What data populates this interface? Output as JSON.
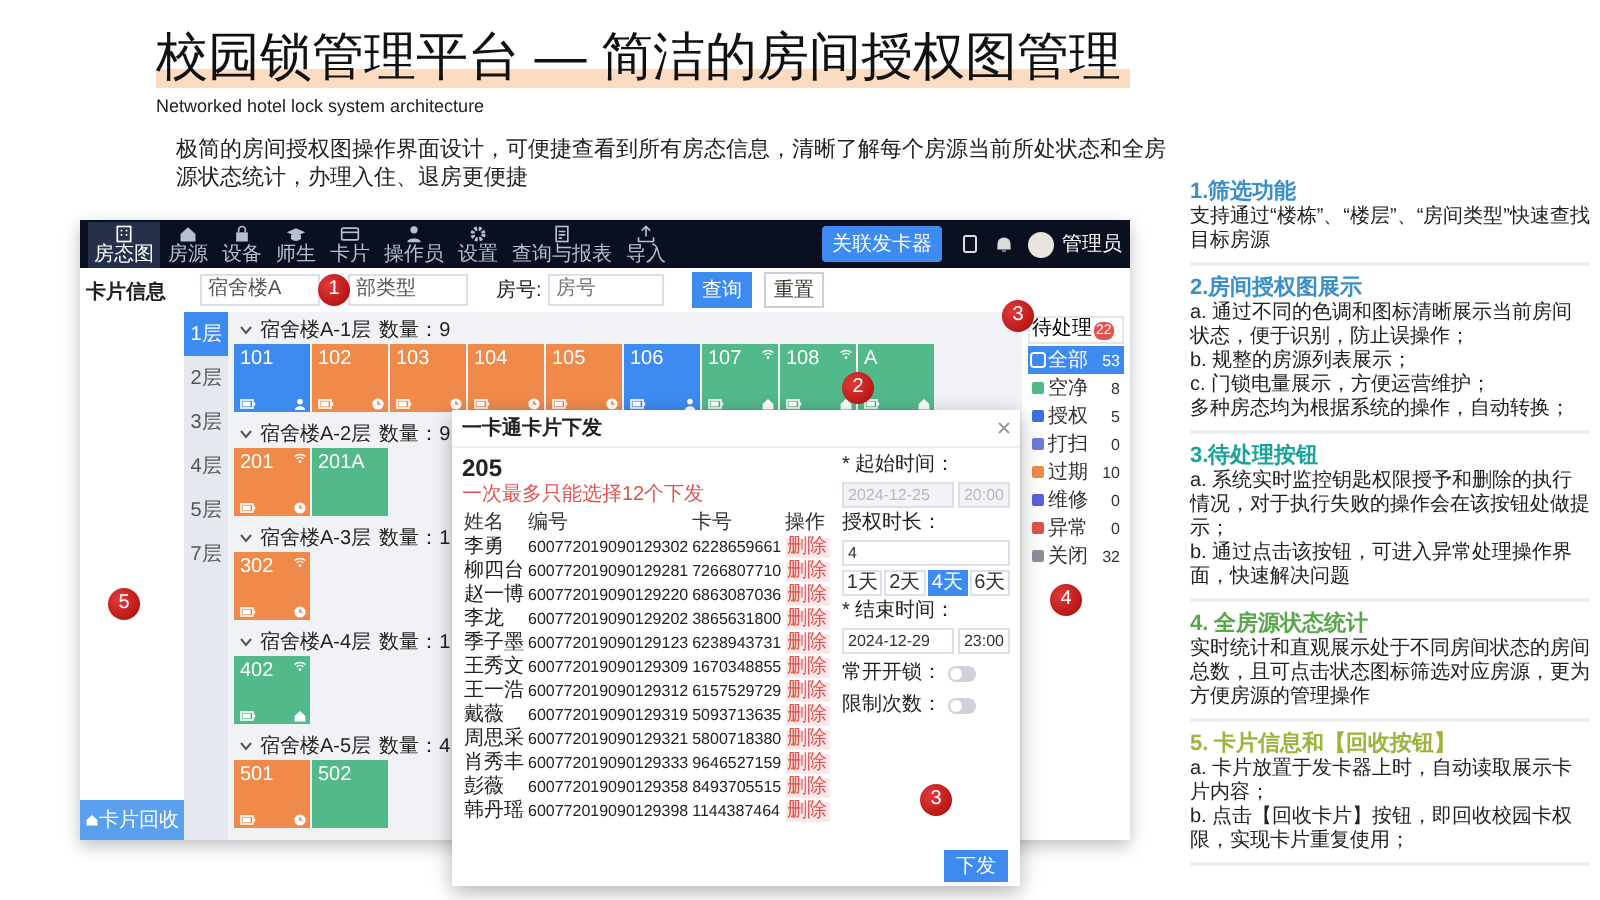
{
  "slide": {
    "title": "校园锁管理平台 — 简洁的房间授权图管理",
    "subtitle": "Networked hotel lock system architecture",
    "description": "极简的房间授权图操作界面设计，可便捷查看到所有房态信息，清晰了解每个房源当前所处状态和全房源状态统计，办理入住、退房更便捷"
  },
  "app": {
    "nav": [
      {
        "label": "房态图",
        "selected": true
      },
      {
        "label": "房源",
        "selected": false
      },
      {
        "label": "设备",
        "selected": false
      },
      {
        "label": "师生",
        "selected": false
      },
      {
        "label": "卡片",
        "selected": false
      },
      {
        "label": "操作员",
        "selected": false
      },
      {
        "label": "设置",
        "selected": false
      },
      {
        "label": "查询与报表",
        "selected": false
      },
      {
        "label": "导入",
        "selected": false
      }
    ],
    "nav_button": "关联发卡器",
    "user": "管理员",
    "card_panel": {
      "title": "卡片信息",
      "button": "卡片回收"
    },
    "filters": {
      "building": "宿舍楼A",
      "room_type": "部类型",
      "room_label": "房号:",
      "room_placeholder": "房号",
      "search": "查询",
      "reset": "重置"
    },
    "floors": [
      {
        "label": "1层",
        "selected": true
      },
      {
        "label": "2层",
        "selected": false
      },
      {
        "label": "3层",
        "selected": false
      },
      {
        "label": "4层",
        "selected": false
      },
      {
        "label": "5层",
        "selected": false
      },
      {
        "label": "7层",
        "selected": false
      }
    ],
    "groups": [
      {
        "title": "宿舍楼A-1层",
        "count": "数量：9",
        "rooms": [
          {
            "number": "101",
            "kind": "occupied",
            "wifi": false,
            "device": true
          },
          {
            "number": "102",
            "kind": "expired",
            "wifi": false,
            "device": true
          },
          {
            "number": "103",
            "kind": "expired",
            "wifi": false,
            "device": true
          },
          {
            "number": "104",
            "kind": "expired",
            "wifi": false,
            "device": true
          },
          {
            "number": "105",
            "kind": "expired",
            "wifi": false,
            "device": true
          },
          {
            "number": "106",
            "kind": "occupied",
            "wifi": false,
            "device": true
          },
          {
            "number": "107",
            "kind": "vacant",
            "wifi": true,
            "device": true
          },
          {
            "number": "108",
            "kind": "vacant",
            "wifi": true,
            "device": true
          },
          {
            "number": "A",
            "kind": "vacant",
            "wifi": false,
            "device": true
          }
        ]
      },
      {
        "title": "宿舍楼A-2层",
        "count": "数量：9",
        "rooms": [
          {
            "number": "201",
            "kind": "expired",
            "wifi": true,
            "device": true
          },
          {
            "number": "201A",
            "kind": "vacant",
            "wifi": false,
            "device": false
          }
        ]
      },
      {
        "title": "宿舍楼A-3层",
        "count": "数量：1",
        "rooms": [
          {
            "number": "302",
            "kind": "expired",
            "wifi": true,
            "device": true
          }
        ]
      },
      {
        "title": "宿舍楼A-4层",
        "count": "数量：1",
        "rooms": [
          {
            "number": "402",
            "kind": "vacant",
            "wifi": true,
            "device": true
          }
        ]
      },
      {
        "title": "宿舍楼A-5层",
        "count": "数量：4",
        "rooms": [
          {
            "number": "501",
            "kind": "expired",
            "wifi": false,
            "device": true
          },
          {
            "number": "502",
            "kind": "vacant",
            "wifi": false,
            "device": false
          }
        ]
      }
    ],
    "pending": {
      "label": "待处理",
      "badge": "22"
    },
    "stats": [
      {
        "label": "全部",
        "count": "53",
        "color": "#3d8bf0",
        "selected": true
      },
      {
        "label": "空净",
        "count": "8",
        "color": "#52b98b",
        "selected": false
      },
      {
        "label": "授权",
        "count": "5",
        "color": "#3d6fe0",
        "selected": false
      },
      {
        "label": "打扫",
        "count": "0",
        "color": "#6c7bd8",
        "selected": false
      },
      {
        "label": "过期",
        "count": "10",
        "color": "#f08a4b",
        "selected": false
      },
      {
        "label": "维修",
        "count": "0",
        "color": "#5b63d6",
        "selected": false
      },
      {
        "label": "异常",
        "count": "0",
        "color": "#e0524f",
        "selected": false
      },
      {
        "label": "关闭",
        "count": "32",
        "color": "#8a8f99",
        "selected": false
      }
    ]
  },
  "dialog": {
    "title": "一卡通卡片下发",
    "room": "205",
    "note": "一次最多只能选择12个下发",
    "columns": [
      "姓名",
      "编号",
      "卡号",
      "操作"
    ],
    "rows": [
      {
        "name": "李勇",
        "code": "600772019090129302",
        "card": "6228659661",
        "action": "删除"
      },
      {
        "name": "柳四台",
        "code": "600772019090129281",
        "card": "7266807710",
        "action": "删除"
      },
      {
        "name": "赵一博",
        "code": "600772019090129220",
        "card": "6863087036",
        "action": "删除"
      },
      {
        "name": "李龙",
        "code": "600772019090129202",
        "card": "3865631800",
        "action": "删除"
      },
      {
        "name": "季子墨",
        "code": "600772019090129123",
        "card": "6238943731",
        "action": "删除"
      },
      {
        "name": "王秀文",
        "code": "600772019090129309",
        "card": "1670348855",
        "action": "删除"
      },
      {
        "name": "王一浩",
        "code": "600772019090129312",
        "card": "6157529729",
        "action": "删除"
      },
      {
        "name": "戴薇",
        "code": "600772019090129319",
        "card": "5093713635",
        "action": "删除"
      },
      {
        "name": "周思采",
        "code": "600772019090129321",
        "card": "5800718380",
        "action": "删除"
      },
      {
        "name": "肖秀丰",
        "code": "600772019090129333",
        "card": "9646527159",
        "action": "删除"
      },
      {
        "name": "彭薇",
        "code": "600772019090129358",
        "card": "8493705515",
        "action": "删除"
      },
      {
        "name": "韩丹瑶",
        "code": "600772019090129398",
        "card": "1144387464",
        "action": "删除"
      }
    ],
    "start": {
      "label": "* 起始时间：",
      "date": "2024-12-25",
      "time": "20:00",
      "disabled": true
    },
    "duration": {
      "label": "授权时长：",
      "value": "4",
      "options": [
        {
          "label": "1天",
          "selected": false
        },
        {
          "label": "2天",
          "selected": false
        },
        {
          "label": "4天",
          "selected": true
        },
        {
          "label": "6天",
          "selected": false
        }
      ]
    },
    "end": {
      "label": "* 结束时间：",
      "date": "2024-12-29",
      "time": "23:00",
      "disabled": false
    },
    "toggles": [
      {
        "label": "常开开锁：",
        "on": false
      },
      {
        "label": "限制次数：",
        "on": false
      }
    ],
    "submit": "下发"
  },
  "markers": [
    {
      "label": "1"
    },
    {
      "label": "2"
    },
    {
      "label": "3"
    },
    {
      "label": "4"
    },
    {
      "label": "5"
    },
    {
      "label": "3"
    }
  ],
  "notes": [
    {
      "title": "1.筛选功能",
      "color": "#3a8fc8",
      "lines": [
        "支持通过“楼栋”、“楼层”、“房间类型”快速查找目标房源"
      ]
    },
    {
      "title": "2.房间授权图展示",
      "color": "#3a8fc8",
      "lines": [
        "a. 通过不同的色调和图标清晰展示当前房间状态，便于识别，防止误操作；",
        "b. 规整的房源列表展示；",
        "c. 门锁电量展示，方便运营维护；",
        "多种房态均为根据系统的操作，自动转换；"
      ]
    },
    {
      "title": "3.待处理按钮",
      "color": "#1aa39a",
      "lines": [
        "a. 系统实时监控钥匙权限授予和删除的执行情况，对于执行失败的操作会在该按钮处做提示；",
        "b. 通过点击该按钮，可进入异常处理操作界面，快速解决问题"
      ]
    },
    {
      "title": "4. 全房源状态统计",
      "color": "#5aa64a",
      "lines": [
        "实时统计和直观展示处于不同房间状态的房间总数，且可点击状态图标筛选对应房源，更为方便房源的管理操作"
      ]
    },
    {
      "title": "5. 卡片信息和【回收按钮】",
      "color": "#9bb53c",
      "lines": [
        "a. 卡片放置于发卡器上时，自动读取展示卡片内容；",
        "b. 点击【回收卡片】按钮，即回收校园卡权限，实现卡片重复使用；"
      ]
    }
  ]
}
